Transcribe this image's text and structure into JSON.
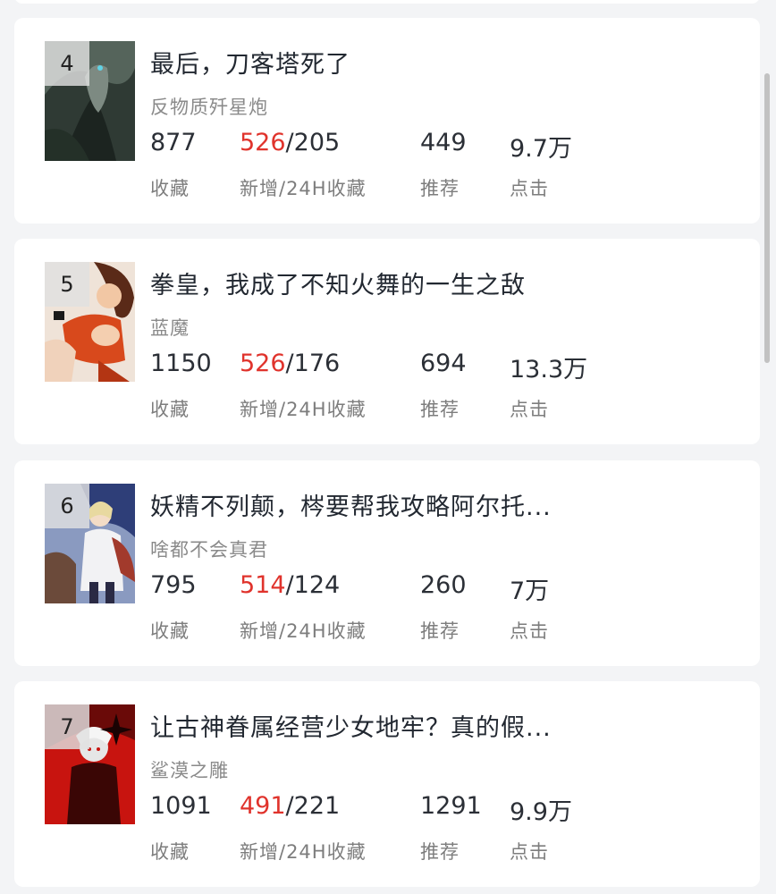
{
  "labels": {
    "favorites": "收藏",
    "new_24h": "新增/24H收藏",
    "recommend": "推荐",
    "clicks": "点击"
  },
  "books": [
    {
      "rank": "4",
      "title": "最后，刀客塔死了",
      "author": "反物质歼星炮",
      "favorites": "877",
      "new_added": "526",
      "h24": "/205",
      "recommend": "449",
      "clicks": "9.7万",
      "cover_colors": [
        "#3c4a42",
        "#6d7a72",
        "#1f2924"
      ]
    },
    {
      "rank": "5",
      "title": "拳皇，我成了不知火舞的一生之敌",
      "author": "蓝魔",
      "favorites": "1150",
      "new_added": "526",
      "h24": "/176",
      "recommend": "694",
      "clicks": "13.3万",
      "cover_colors": [
        "#f2e6dc",
        "#d8491c",
        "#5a2a18"
      ]
    },
    {
      "rank": "6",
      "title": "妖精不列颠，梣要帮我攻略阿尔托...",
      "author": "啥都不会真君",
      "favorites": "795",
      "new_added": "514",
      "h24": "/124",
      "recommend": "260",
      "clicks": "7万",
      "cover_colors": [
        "#6f7fa6",
        "#e8d9a0",
        "#a23a2c"
      ]
    },
    {
      "rank": "7",
      "title": "让古神眷属经营少女地牢？真的假...",
      "author": "鲨漠之雕",
      "favorites": "1091",
      "new_added": "491",
      "h24": "/221",
      "recommend": "1291",
      "clicks": "9.9万",
      "cover_colors": [
        "#c8140f",
        "#5a0a08",
        "#e6e6e6"
      ]
    }
  ]
}
